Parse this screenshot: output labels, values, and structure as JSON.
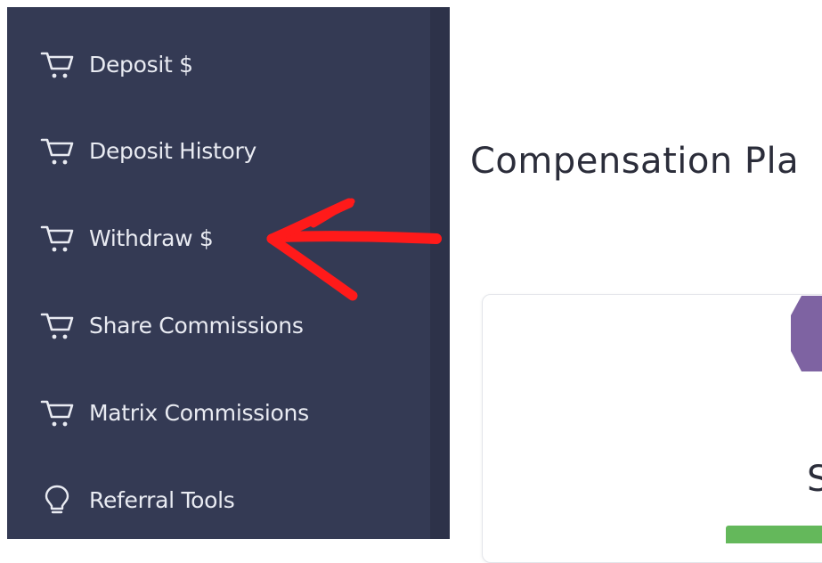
{
  "sidebar": {
    "items": [
      {
        "label": "Deposit $",
        "icon": "cart-icon"
      },
      {
        "label": "Deposit History",
        "icon": "cart-icon"
      },
      {
        "label": "Withdraw $",
        "icon": "cart-icon"
      },
      {
        "label": "Share Commissions",
        "icon": "cart-icon"
      },
      {
        "label": "Matrix Commissions",
        "icon": "cart-icon"
      },
      {
        "label": "Referral Tools",
        "icon": "lightbulb-icon"
      }
    ]
  },
  "main": {
    "title": "Compensation Pla",
    "card_glyph": "S"
  },
  "colors": {
    "sidebar_bg": "#343a54",
    "sidebar_text": "#e9ebf2",
    "annotation": "#ff1a1a",
    "hex_logo": "#7e63a2",
    "button": "#64b85b"
  }
}
